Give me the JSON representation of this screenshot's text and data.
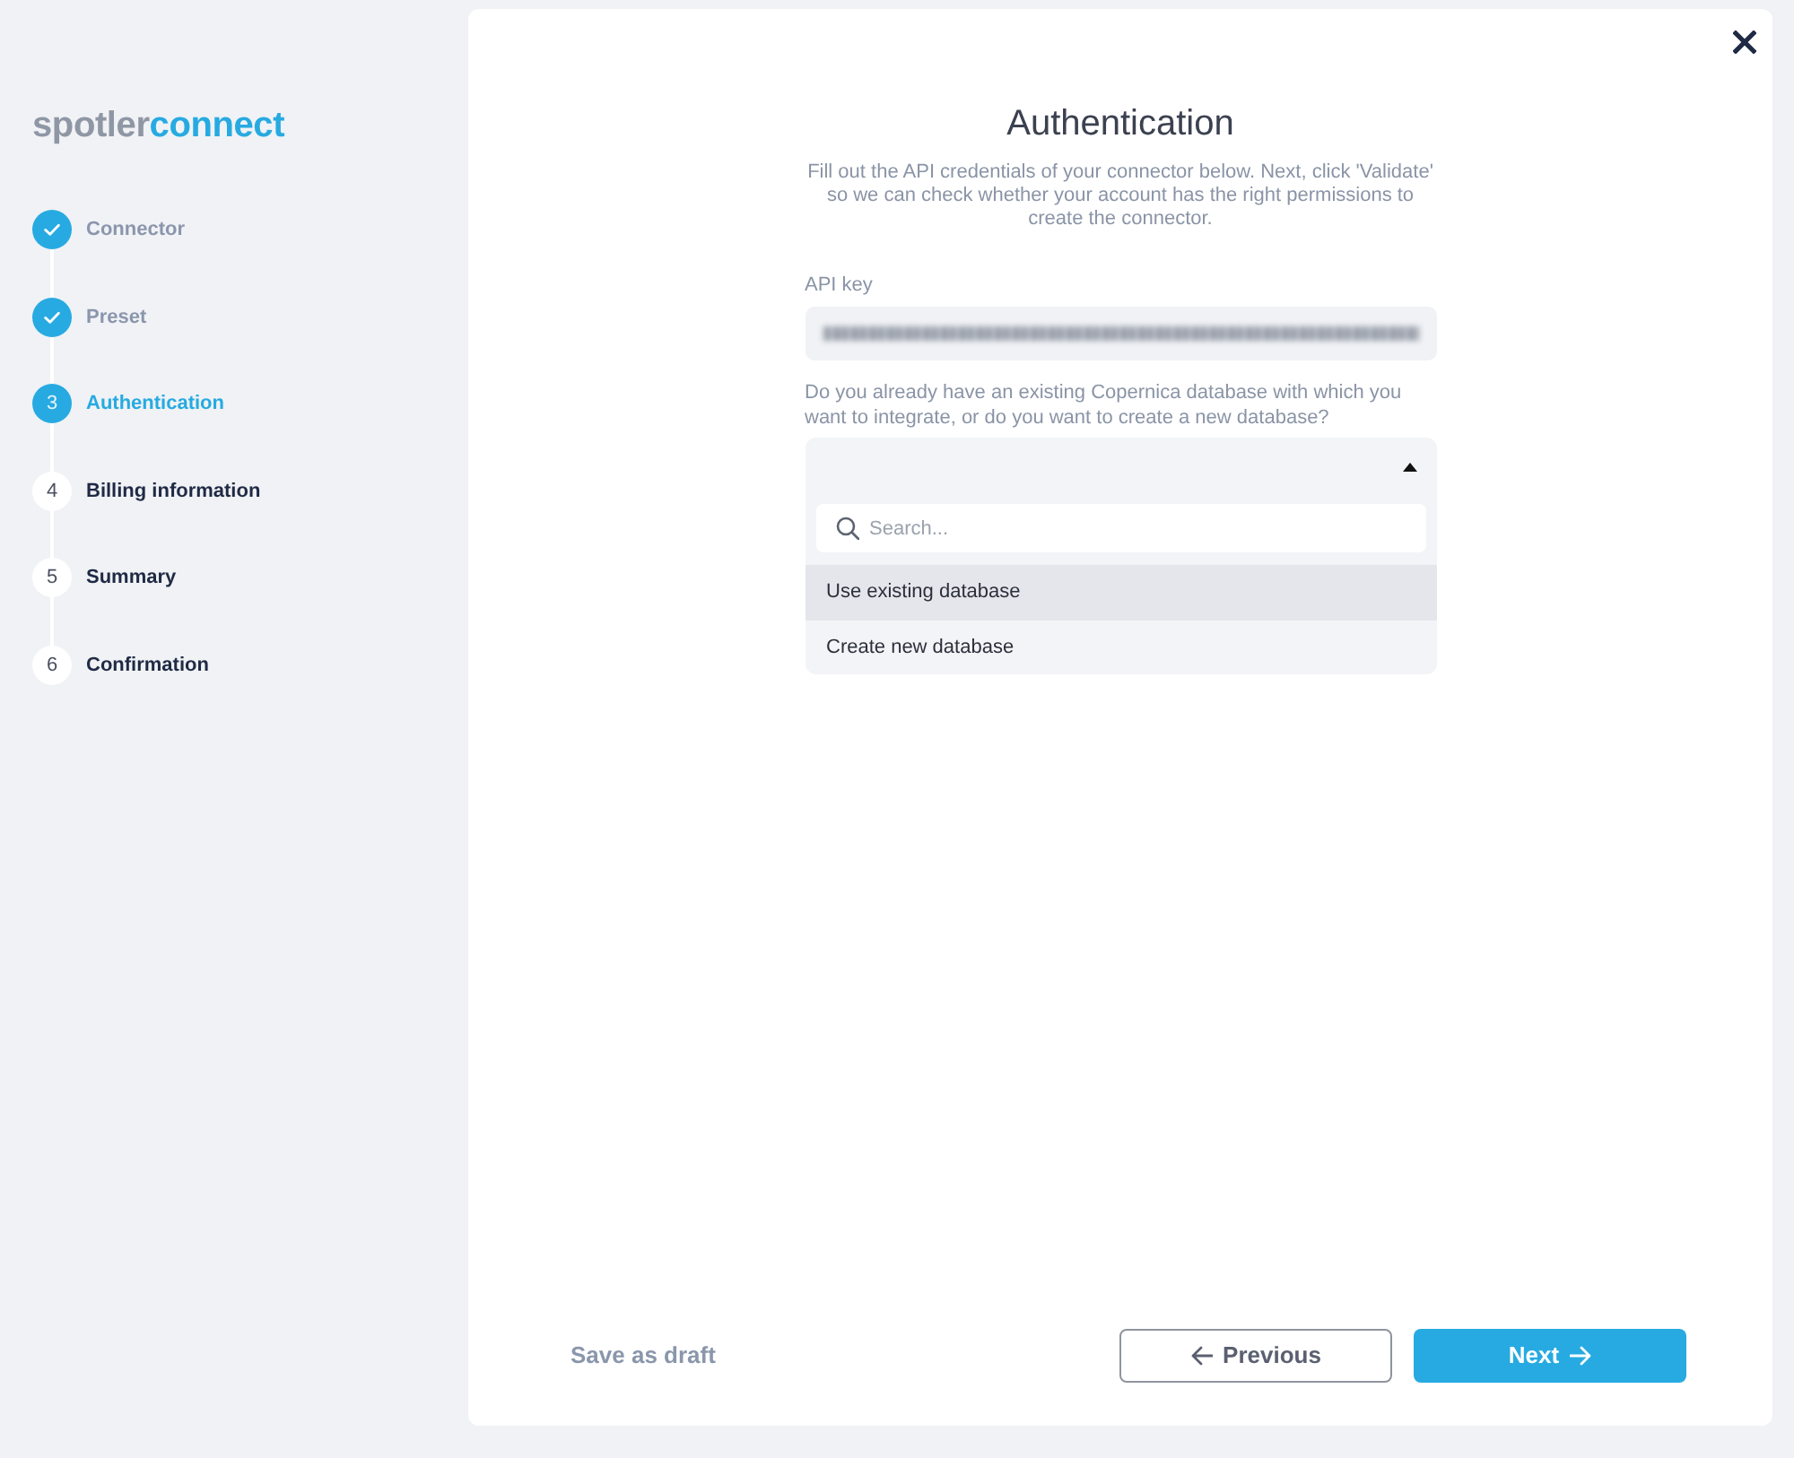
{
  "sidebar": {
    "logo": {
      "brand": "spotler",
      "product": "connect"
    },
    "steps": [
      {
        "label": "Connector",
        "completed": true,
        "selected": false
      },
      {
        "label": "Preset",
        "completed": true,
        "selected": false
      },
      {
        "number": "3",
        "label": "Authentication",
        "completed": false,
        "selected": true
      },
      {
        "number": "4",
        "label": "Billing information",
        "completed": false,
        "selected": false
      },
      {
        "number": "5",
        "label": "Summary",
        "completed": false,
        "selected": false
      },
      {
        "number": "6",
        "label": "Confirmation",
        "completed": false,
        "selected": false
      }
    ]
  },
  "main": {
    "title": "Authentication",
    "description": "Fill out the API credentials of your connector below. Next, click 'Validate' so we can check whether your account has the right permissions to create the connector.",
    "api_key": {
      "label": "API key",
      "value_blurred": true
    },
    "database": {
      "label": "Do you already have an existing Copernica database with which you want to integrate, or do you want to create a new database?",
      "expanded": true,
      "search": {
        "placeholder": "Search..."
      },
      "options": [
        {
          "label": "Use existing database",
          "selected": true
        },
        {
          "label": "Create new database",
          "selected": false
        }
      ]
    }
  },
  "footer": {
    "save_draft": "Save as draft",
    "previous": "Previous",
    "next": "Next"
  }
}
